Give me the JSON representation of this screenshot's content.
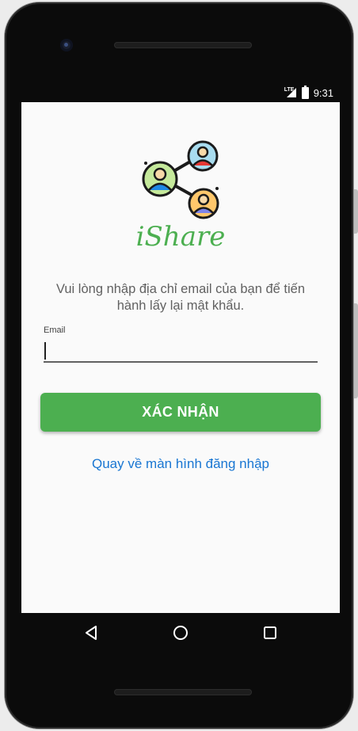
{
  "status_bar": {
    "network_icon": "lte-signal-icon",
    "battery_icon": "battery-icon",
    "time": "9:31",
    "lte_label": "LTE"
  },
  "app": {
    "logo_icon": "share-network-people-icon",
    "brand_name": "iShare",
    "brand_color": "#4caf50"
  },
  "forgot_password": {
    "instruction": "Vui lòng nhập địa chỉ email của bạn để tiến hành lấy lại mật khẩu.",
    "email_label": "Email",
    "email_value": "",
    "confirm_label": "XÁC NHẬN",
    "back_to_login": "Quay về màn hình đăng nhập"
  },
  "nav_bar": {
    "back_icon": "triangle-back-icon",
    "home_icon": "circle-home-icon",
    "recents_icon": "square-recents-icon"
  },
  "colors": {
    "accent": "#4caf50",
    "link": "#1976d2",
    "text_secondary": "#616161",
    "screen_bg": "#fafafa"
  }
}
